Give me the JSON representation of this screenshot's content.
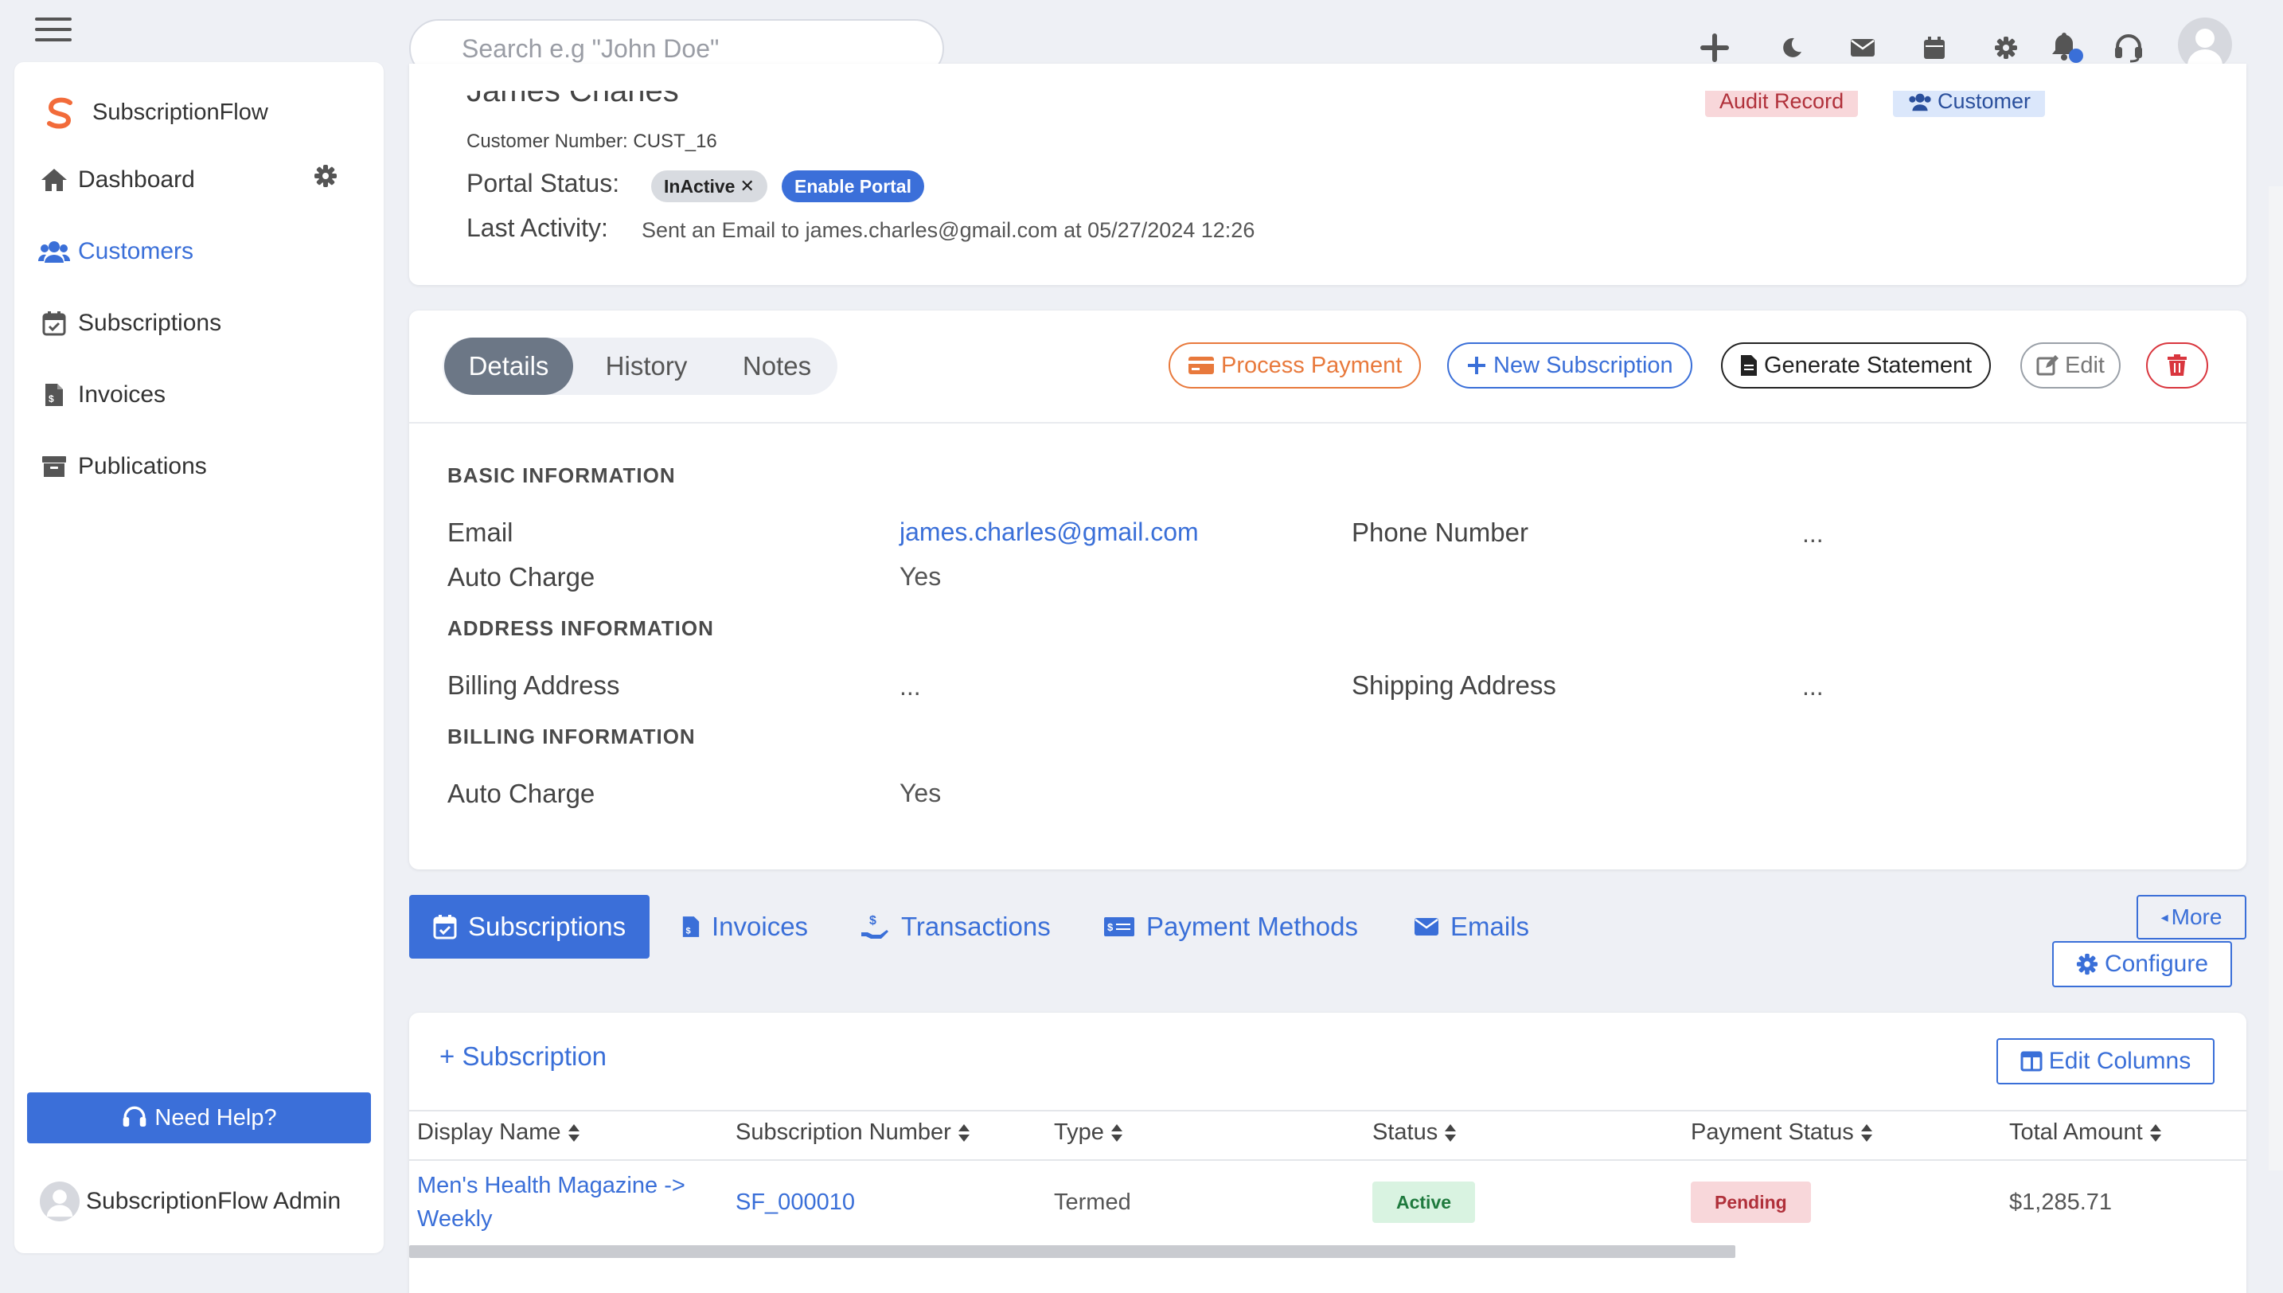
{
  "topbar": {
    "search_placeholder": "Search e.g \"John Doe\"",
    "icons": [
      "plus-icon",
      "moon-icon",
      "envelope-icon",
      "calendar-icon",
      "gear-icon",
      "bell-icon",
      "headset-icon",
      "user-avatar"
    ],
    "notification_dot_color": "#3a6fd8"
  },
  "sidebar": {
    "brand": "SubscriptionFlow",
    "brand_color": "#f26b3a",
    "items": [
      {
        "label": "Dashboard",
        "icon": "home-icon",
        "active": false
      },
      {
        "label": "Customers",
        "icon": "users-icon",
        "active": true
      },
      {
        "label": "Subscriptions",
        "icon": "calendar-check-icon",
        "active": false
      },
      {
        "label": "Invoices",
        "icon": "file-invoice-icon",
        "active": false
      },
      {
        "label": "Publications",
        "icon": "archive-icon",
        "active": false
      }
    ],
    "help_button": "Need Help?",
    "admin_name": "SubscriptionFlow Admin"
  },
  "customer": {
    "name": "James Charles",
    "customer_number": "Customer Number: CUST_16",
    "badges": {
      "audit": "Audit Record",
      "customer": "Customer"
    },
    "portal_status_label": "Portal Status:",
    "portal_status_value": "InActive",
    "enable_portal": "Enable Portal",
    "last_activity_label": "Last Activity:",
    "last_activity_value": "Sent an Email to james.charles@gmail.com at 05/27/2024 12:26"
  },
  "detail_tabs": {
    "tabs": [
      "Details",
      "History",
      "Notes"
    ],
    "active": "Details"
  },
  "actions": {
    "process_payment": "Process Payment",
    "new_subscription": "New Subscription",
    "generate_statement": "Generate Statement",
    "edit": "Edit"
  },
  "details": {
    "basic_heading": "BASIC INFORMATION",
    "email_label": "Email",
    "email_value": "james.charles@gmail.com",
    "phone_label": "Phone Number",
    "phone_value": "...",
    "auto_charge_label": "Auto Charge",
    "auto_charge_value": "Yes",
    "address_heading": "ADDRESS INFORMATION",
    "billing_label": "Billing Address",
    "billing_value": "...",
    "shipping_label": "Shipping Address",
    "shipping_value": "...",
    "billing_heading": "BILLING INFORMATION",
    "billing_auto_charge_label": "Auto Charge",
    "billing_auto_charge_value": "Yes"
  },
  "lower_tabs": {
    "tabs": [
      "Subscriptions",
      "Invoices",
      "Transactions",
      "Payment Methods",
      "Emails"
    ],
    "active": "Subscriptions",
    "more": "More",
    "configure": "Configure"
  },
  "subscriptions_table": {
    "add_label": "+ Subscription",
    "edit_columns": "Edit Columns",
    "columns": [
      "Display Name",
      "Subscription Number",
      "Type",
      "Status",
      "Payment Status",
      "Total Amount"
    ],
    "rows": [
      {
        "display_name_line1": "Men's Health Magazine ->",
        "display_name_line2": "Weekly",
        "subscription_number": "SF_000010",
        "type": "Termed",
        "status": "Active",
        "payment_status": "Pending",
        "total_amount": "$1,285.71"
      }
    ]
  },
  "colors": {
    "primary": "#3b6fd9",
    "process_payment": "#e8793c",
    "delete": "#d9363e",
    "active_badge_bg": "#d9f3e1",
    "active_badge_fg": "#1f7a3e",
    "pending_badge_bg": "#f8d7da",
    "pending_badge_fg": "#b0303a"
  }
}
